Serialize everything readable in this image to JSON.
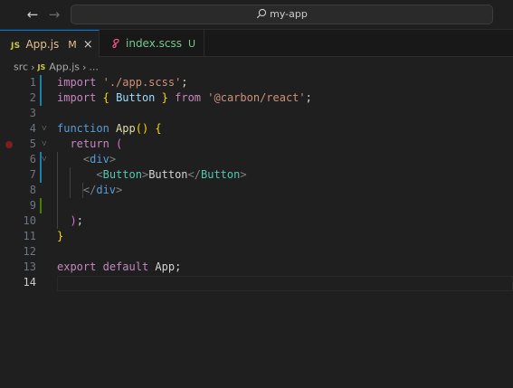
{
  "titlebar": {
    "back_icon": "arrow-left-icon",
    "forward_icon": "arrow-right-icon",
    "search_text": "my-app"
  },
  "tabs": [
    {
      "icon_text": "JS",
      "label": "App.js",
      "badge": "M",
      "close_glyph": "×",
      "active": true
    },
    {
      "icon_name": "sass-icon",
      "label": "index.scss",
      "badge": "U",
      "active": false
    }
  ],
  "breadcrumb": {
    "folder": "src",
    "file_icon_text": "JS",
    "file": "App.js",
    "more": "..."
  },
  "editor": {
    "lines": [
      {
        "n": "1",
        "parts": [
          [
            "kw",
            "import"
          ],
          [
            "punc",
            " "
          ],
          [
            "str",
            "'./app.scss'"
          ],
          [
            "punc",
            ";"
          ]
        ]
      },
      {
        "n": "2",
        "parts": [
          [
            "kw",
            "import"
          ],
          [
            "punc",
            " "
          ],
          [
            "br1",
            "{"
          ],
          [
            "punc",
            " "
          ],
          [
            "var",
            "Button"
          ],
          [
            "punc",
            " "
          ],
          [
            "br1",
            "}"
          ],
          [
            "punc",
            " "
          ],
          [
            "kw",
            "from"
          ],
          [
            "punc",
            " "
          ],
          [
            "str",
            "'@carbon/react'"
          ],
          [
            "punc",
            ";"
          ]
        ]
      },
      {
        "n": "3",
        "parts": []
      },
      {
        "n": "4",
        "parts": [
          [
            "kw2",
            "function"
          ],
          [
            "punc",
            " "
          ],
          [
            "fn",
            "App"
          ],
          [
            "br1",
            "()"
          ],
          [
            "punc",
            " "
          ],
          [
            "br1",
            "{"
          ]
        ]
      },
      {
        "n": "5",
        "parts": [
          [
            "punc",
            "  "
          ],
          [
            "kw",
            "return"
          ],
          [
            "punc",
            " "
          ],
          [
            "br2",
            "("
          ]
        ]
      },
      {
        "n": "6",
        "parts": [
          [
            "punc",
            "    "
          ],
          [
            "tagp",
            "<"
          ],
          [
            "tag",
            "div"
          ],
          [
            "tagp",
            ">"
          ]
        ]
      },
      {
        "n": "7",
        "parts": [
          [
            "punc",
            "      "
          ],
          [
            "tagp",
            "<"
          ],
          [
            "comp",
            "Button"
          ],
          [
            "tagp",
            ">"
          ],
          [
            "txt",
            "Button"
          ],
          [
            "tagp",
            "</"
          ],
          [
            "comp",
            "Button"
          ],
          [
            "tagp",
            ">"
          ]
        ]
      },
      {
        "n": "8",
        "parts": [
          [
            "punc",
            "    "
          ],
          [
            "tagp",
            "</"
          ],
          [
            "tag",
            "div"
          ],
          [
            "tagp",
            ">"
          ]
        ]
      },
      {
        "n": "9",
        "parts": []
      },
      {
        "n": "10",
        "parts": [
          [
            "punc",
            "  "
          ],
          [
            "br2",
            ")"
          ],
          [
            "punc",
            ";"
          ]
        ]
      },
      {
        "n": "11",
        "parts": [
          [
            "br1",
            "}"
          ]
        ]
      },
      {
        "n": "12",
        "parts": []
      },
      {
        "n": "13",
        "parts": [
          [
            "kw",
            "export"
          ],
          [
            "punc",
            " "
          ],
          [
            "kw",
            "default"
          ],
          [
            "punc",
            " "
          ],
          [
            "txt",
            "App"
          ],
          [
            "punc",
            ";"
          ]
        ]
      },
      {
        "n": "14",
        "parts": []
      }
    ]
  },
  "colors": {
    "background": "#1f1f1f",
    "accent": "#0078d4",
    "modified": "#e2c08d",
    "untracked": "#73c991"
  }
}
